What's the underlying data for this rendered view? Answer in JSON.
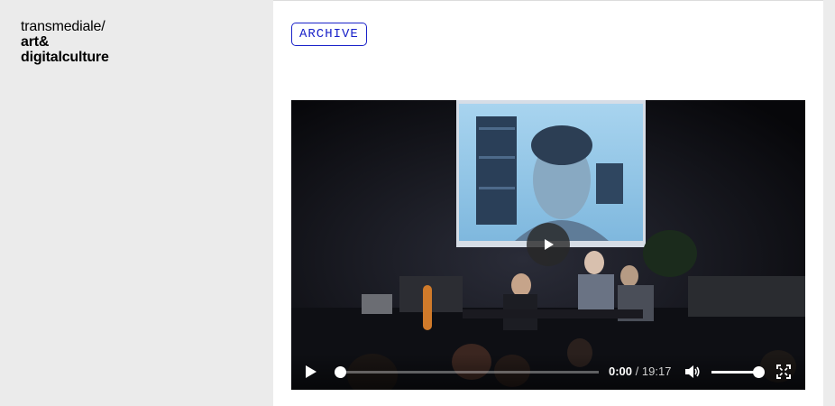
{
  "brand": {
    "line1": "transmediale/",
    "line2": "art&",
    "line3": "digitalculture"
  },
  "badge": {
    "label": "ARCHIVE",
    "color": "#1a22c9"
  },
  "video": {
    "current_time": "0:00",
    "separator": "/",
    "duration": "19:17",
    "progress_fraction": 0.0,
    "volume_fraction": 1.0,
    "icons": {
      "big_play": "play-icon",
      "play": "play-icon",
      "volume": "volume-icon",
      "fullscreen": "fullscreen-icon"
    }
  }
}
